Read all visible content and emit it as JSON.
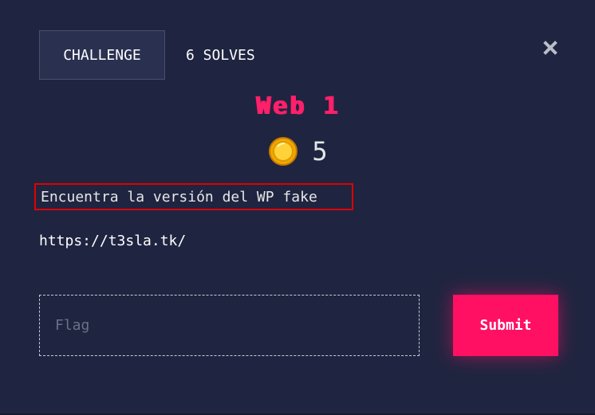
{
  "modal": {
    "tabs": [
      {
        "label": "CHALLENGE"
      },
      {
        "label": "6 SOLVES"
      }
    ],
    "close_icon": "close-icon",
    "title": "Web 1",
    "points": "5",
    "points_icon": "coin-icon",
    "description": "Encuentra la versión del WP fake",
    "url": "https://t3sla.tk/",
    "flag_input": {
      "value": "",
      "placeholder": "Flag"
    },
    "submit_label": "Submit"
  },
  "colors": {
    "background": "#1f2540",
    "accent": "#ff1062",
    "highlight_border": "#e00000",
    "coin": "#f5b800"
  }
}
